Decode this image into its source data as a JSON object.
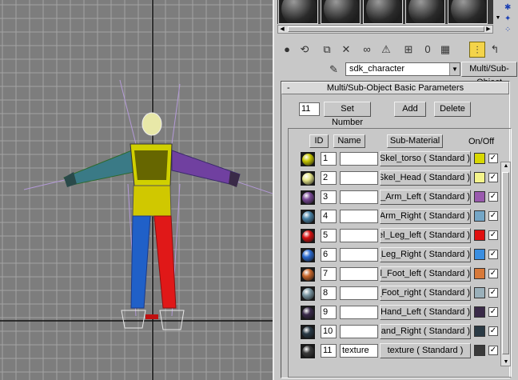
{
  "panel": {
    "object_name": "sdk_character",
    "material_type_button": "Multi/Sub-Object",
    "rollout_title": "Multi/Sub-Object Basic Parameters",
    "rollout_toggle": "-",
    "material_count": "11",
    "set_number_label": "Set Number",
    "add_label": "Add",
    "delete_label": "Delete",
    "columns": {
      "id": "ID",
      "name": "Name",
      "sub_material": "Sub-Material",
      "onoff": "On/Off"
    }
  },
  "rows": [
    {
      "id": "1",
      "name": "",
      "material": "Skel_torso  ( Standard )",
      "color": "#d8d800",
      "sphere": "#c8c800",
      "on": true
    },
    {
      "id": "2",
      "name": "",
      "material": "Skel_Head  ( Standard )",
      "color": "#f4f48a",
      "sphere": "#e6e68a",
      "on": true
    },
    {
      "id": "3",
      "name": "",
      "material": "Skel_Arm_Left  ( Standard )",
      "color": "#9a5aae",
      "sphere": "#7a4a98",
      "on": true
    },
    {
      "id": "4",
      "name": "",
      "material": "Skel_Arm_Right  ( Standard )",
      "color": "#74a6c6",
      "sphere": "#4a84a8",
      "on": true
    },
    {
      "id": "5",
      "name": "",
      "material": "Skel_Leg_left  ( Standard )",
      "color": "#e01010",
      "sphere": "#d81010",
      "on": true
    },
    {
      "id": "6",
      "name": "",
      "material": "Skel_Leg_Right  ( Standard )",
      "color": "#3a8ee0",
      "sphere": "#2a6ad0",
      "on": true
    },
    {
      "id": "7",
      "name": "",
      "material": "Skel_Foot_left  ( Standard )",
      "color": "#d87a3a",
      "sphere": "#c8662a",
      "on": true
    },
    {
      "id": "8",
      "name": "",
      "material": "Skel_Foot_right  ( Standard )",
      "color": "#9ab0ba",
      "sphere": "#7a96a2",
      "on": true
    },
    {
      "id": "9",
      "name": "",
      "material": "Skel_Hand_Left  ( Standard )",
      "color": "#3a2a48",
      "sphere": "#3a2a4a",
      "on": true
    },
    {
      "id": "10",
      "name": "",
      "material": "Skel_Hand_Right  ( Standard )",
      "color": "#2a3a44",
      "sphere": "#2a3a46",
      "on": true
    },
    {
      "id": "11",
      "name": "texture",
      "material": "texture  ( Standard )",
      "color": "#3a3a3a",
      "sphere": "#3a3a3a",
      "on": true
    }
  ],
  "colors": {
    "viewport_bg": "#7d7d7d",
    "panel_bg": "#c8c8c8",
    "selected_tool": "#f4d44a"
  },
  "icons": [
    "get-material-icon",
    "put-to-scene-icon",
    "assign-material-icon",
    "reset-map-icon",
    "make-copy-icon",
    "make-unique-icon",
    "put-to-library-icon",
    "material-effects-channel-icon",
    "show-map-in-viewport-icon",
    "show-end-result-icon",
    "go-to-parent-icon",
    "pick-from-object-icon"
  ]
}
